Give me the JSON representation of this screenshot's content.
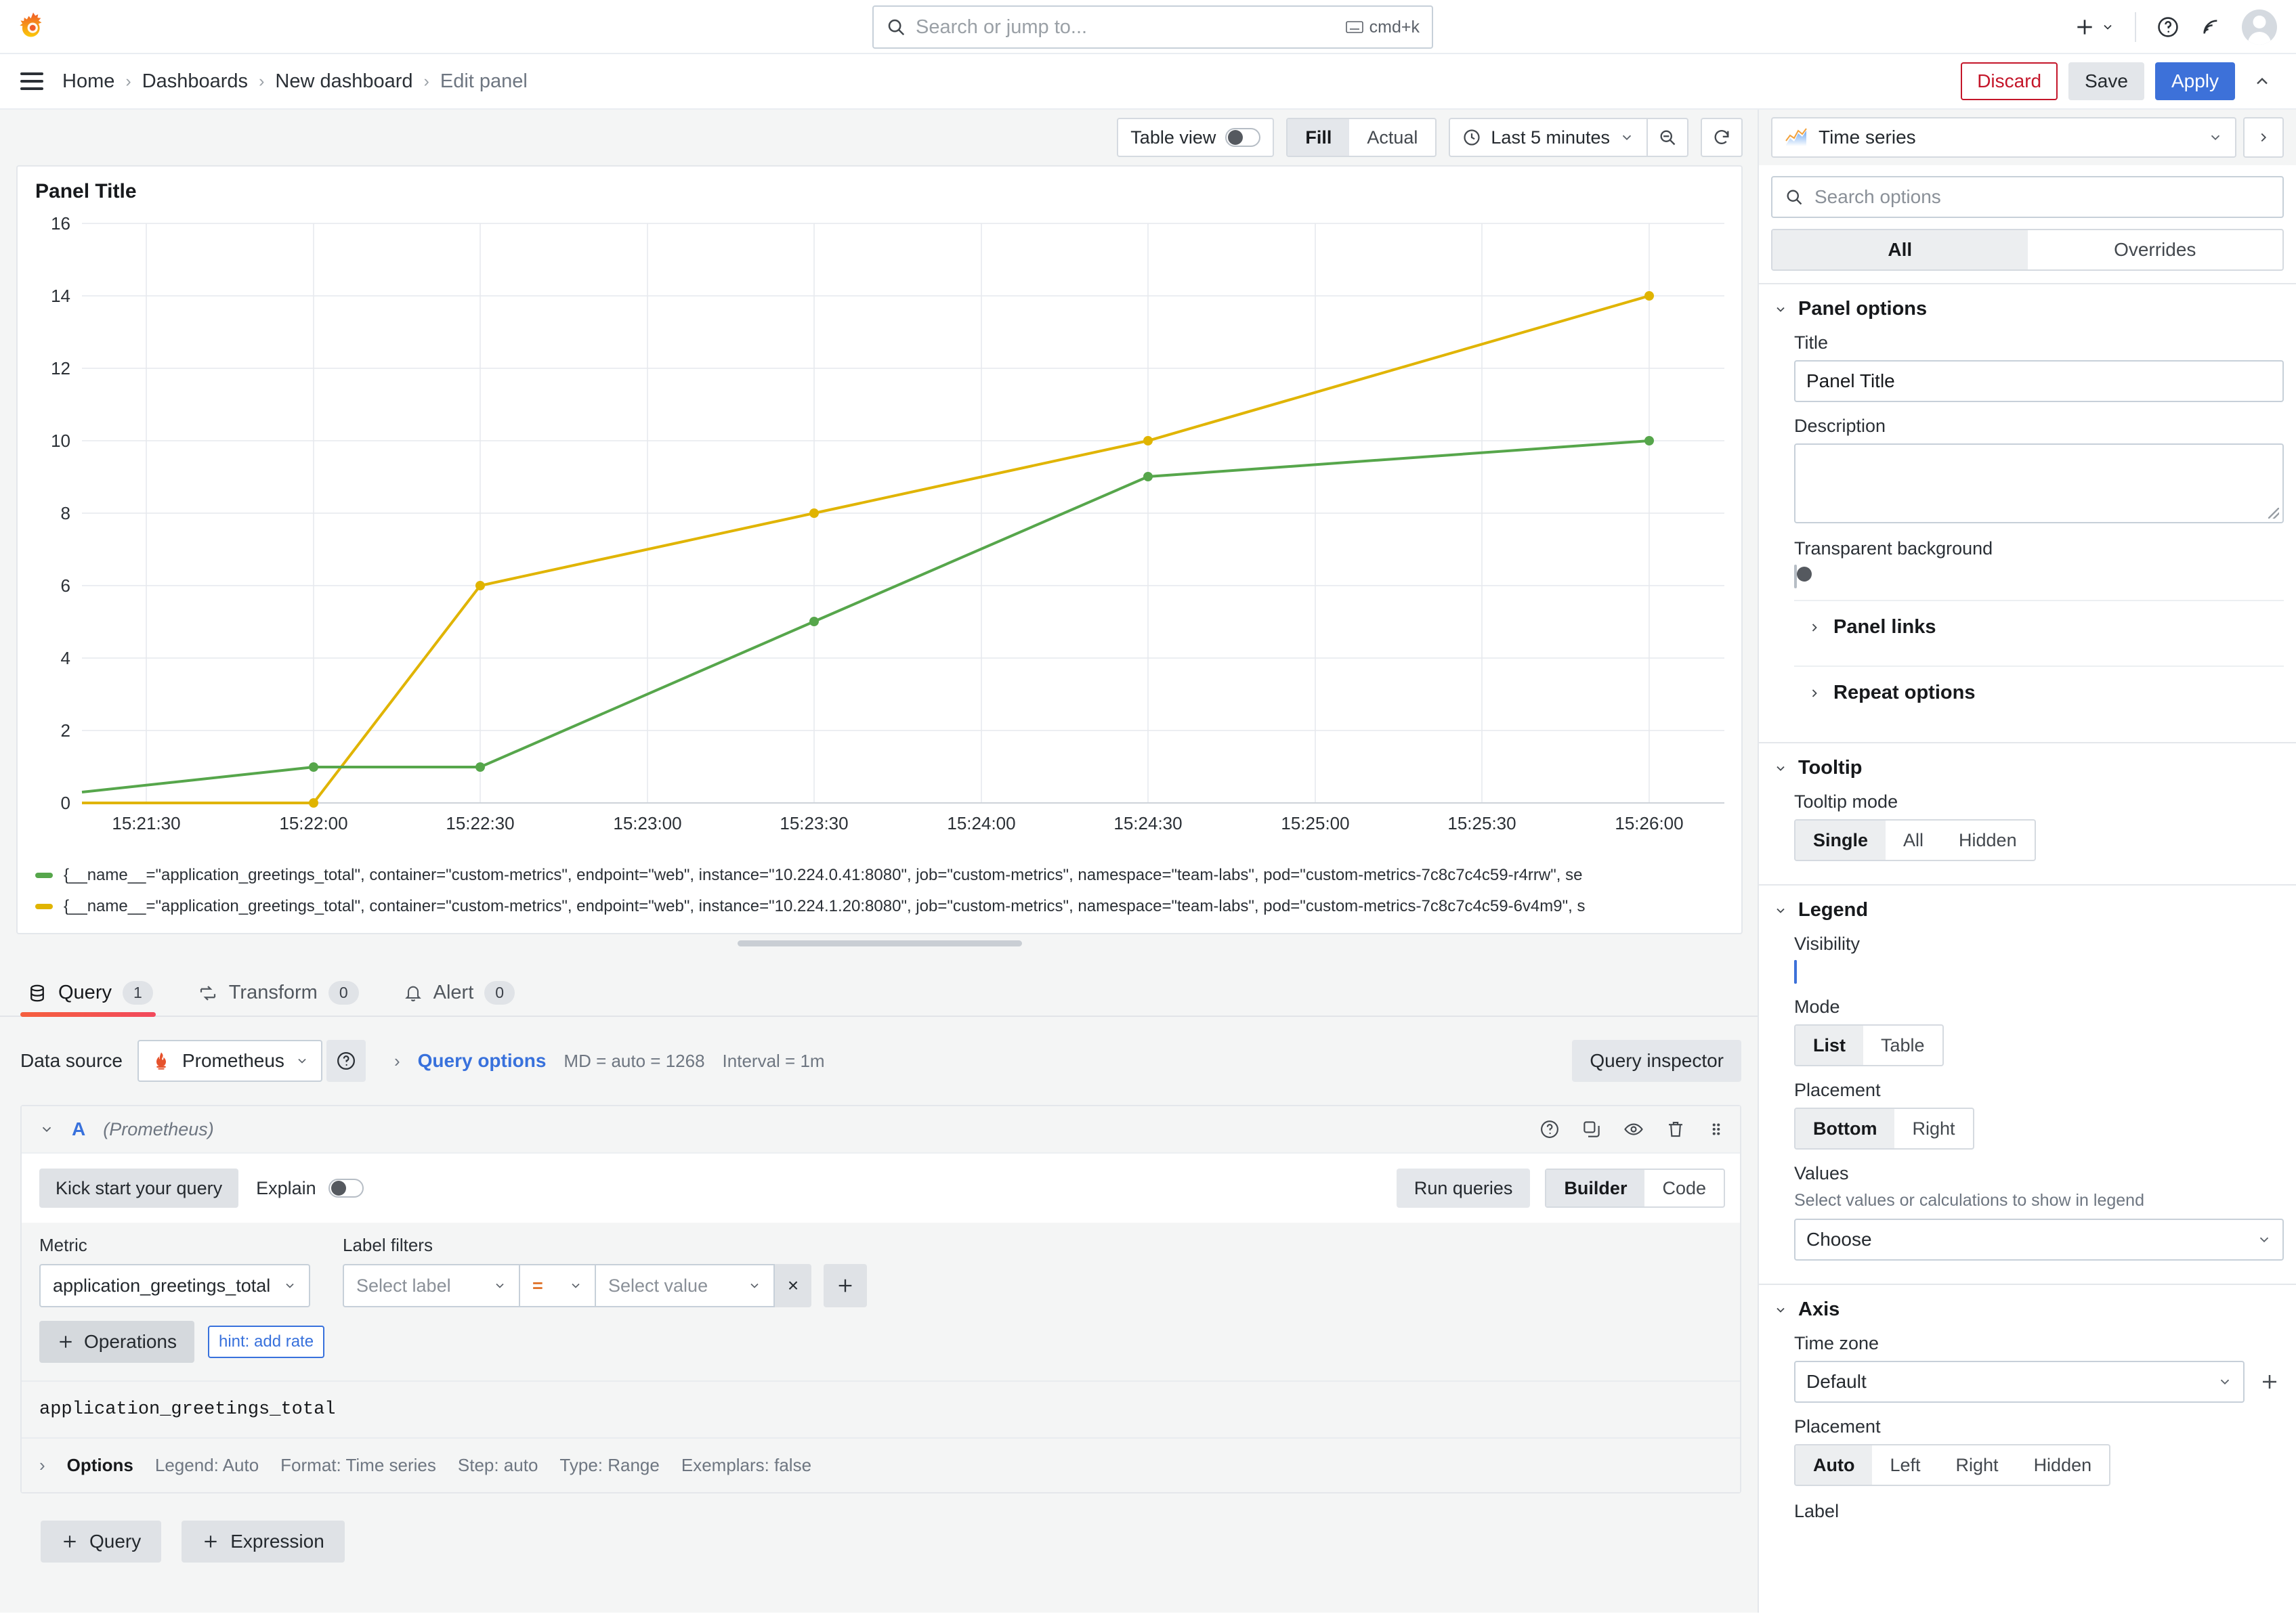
{
  "topnav": {
    "logo_icon": "grafana-logo-icon",
    "search_placeholder": "Search or jump to...",
    "search_value": "",
    "kbd_shortcut": "cmd+k",
    "add_icon": "plus-icon",
    "help_icon": "question-circle-icon",
    "news_icon": "rss-icon",
    "avatar_icon": "user-avatar-icon"
  },
  "breadcrumb": {
    "menu_icon": "hamburger-menu-icon",
    "items": [
      "Home",
      "Dashboards",
      "New dashboard",
      "Edit panel"
    ],
    "separator": "›",
    "discard_label": "Discard",
    "save_label": "Save",
    "apply_label": "Apply",
    "collapse_icon": "chevron-up-icon"
  },
  "panel_toolbar": {
    "table_view_label": "Table view",
    "table_view_on": false,
    "fill_actual": [
      "Fill",
      "Actual"
    ],
    "fill_actual_selected": "Fill",
    "time_range": "Last 5 minutes",
    "time_icon": "clock-icon",
    "zoom_out_icon": "zoom-out-icon",
    "refresh_icon": "refresh-icon"
  },
  "panel": {
    "title": "Panel Title",
    "legend": [
      {
        "color": "#56a64b",
        "text": "{__name__=\"application_greetings_total\", container=\"custom-metrics\", endpoint=\"web\", instance=\"10.224.0.41:8080\", job=\"custom-metrics\", namespace=\"team-labs\", pod=\"custom-metrics-7c8c7c4c59-r4rrw\", se"
      },
      {
        "color": "#e0b400",
        "text": "{__name__=\"application_greetings_total\", container=\"custom-metrics\", endpoint=\"web\", instance=\"10.224.1.20:8080\", job=\"custom-metrics\", namespace=\"team-labs\", pod=\"custom-metrics-7c8c7c4c59-6v4m9\", s"
      }
    ]
  },
  "chart_data": {
    "type": "line",
    "title": "Panel Title",
    "xlabel": "",
    "ylabel": "",
    "ylim": [
      0,
      16
    ],
    "yticks": [
      0,
      2,
      4,
      6,
      8,
      10,
      12,
      14,
      16
    ],
    "xticks": [
      "15:21:30",
      "15:22:00",
      "15:22:30",
      "15:23:00",
      "15:23:30",
      "15:24:00",
      "15:24:30",
      "15:25:00",
      "15:25:30",
      "15:26:00"
    ],
    "grid": true,
    "legend_position": "bottom",
    "x": [
      "15:21:20",
      "15:22:00",
      "15:23:00",
      "15:24:00",
      "15:25:00",
      "15:26:00"
    ],
    "series": [
      {
        "name": "{__name__=\"application_greetings_total\", instance=\"10.224.0.41:8080\", pod=\"custom-metrics-7c8c7c4c59-r4rrw\"}",
        "color": "#56a64b",
        "values": [
          0.3,
          1,
          1,
          5,
          9,
          10
        ]
      },
      {
        "name": "{__name__=\"application_greetings_total\", instance=\"10.224.1.20:8080\", pod=\"custom-metrics-7c8c7c4c59-6v4m9\"}",
        "color": "#e0b400",
        "values": [
          0,
          0,
          6,
          8,
          10,
          14
        ]
      }
    ]
  },
  "query_tabs": [
    {
      "label": "Query",
      "count": "1",
      "icon": "database-icon",
      "active": true
    },
    {
      "label": "Transform",
      "count": "0",
      "icon": "transform-icon",
      "active": false
    },
    {
      "label": "Alert",
      "count": "0",
      "icon": "bell-icon",
      "active": false
    }
  ],
  "datasource": {
    "label": "Data source",
    "name": "Prometheus",
    "icon": "prometheus-icon",
    "help_icon": "question-circle-icon",
    "query_options_label": "Query options",
    "max_data_points": "MD = auto = 1268",
    "interval": "Interval = 1m",
    "query_inspector_label": "Query inspector"
  },
  "query_a": {
    "ref_id": "A",
    "datasource_name": "(Prometheus)",
    "collapse_icon": "chevron-down-icon",
    "icons": [
      "help-icon",
      "duplicate-icon",
      "eye-icon",
      "trash-icon",
      "drag-handle-icon"
    ],
    "kick_start_label": "Kick start your query",
    "explain_label": "Explain",
    "explain_on": false,
    "run_queries_label": "Run queries",
    "editor_modes": [
      "Builder",
      "Code"
    ],
    "editor_mode_selected": "Builder",
    "metric_label": "Metric",
    "metric_value": "application_greetings_total",
    "label_filters_label": "Label filters",
    "filter_label_placeholder": "Select label",
    "filter_operator": "=",
    "filter_value_placeholder": "Select value",
    "remove_filter_icon": "close-icon",
    "add_filter_icon": "plus-icon",
    "operations_label": "Operations",
    "hint_label": "hint: add rate",
    "promql": "application_greetings_total",
    "options_label": "Options",
    "options_summary": [
      "Legend: Auto",
      "Format: Time series",
      "Step: auto",
      "Type: Range",
      "Exemplars: false"
    ]
  },
  "add_buttons": {
    "query_label": "Query",
    "expression_label": "Expression",
    "plus_icon": "plus-icon"
  },
  "options_pane": {
    "viz_name": "Time series",
    "viz_icon": "timeseries-icon",
    "viz_chevron_icon": "chevron-down-icon",
    "viz_next_icon": "chevron-right-icon",
    "search_placeholder": "Search options",
    "search_value": "",
    "tabs": [
      "All",
      "Overrides"
    ],
    "tab_selected": "All",
    "panel_options": {
      "header": "Panel options",
      "title_label": "Title",
      "title_value": "Panel Title",
      "description_label": "Description",
      "description_value": "",
      "transparent_label": "Transparent background",
      "transparent_on": false,
      "panel_links_label": "Panel links",
      "repeat_options_label": "Repeat options"
    },
    "tooltip": {
      "header": "Tooltip",
      "mode_label": "Tooltip mode",
      "mode_options": [
        "Single",
        "All",
        "Hidden"
      ],
      "mode_selected": "Single"
    },
    "legend": {
      "header": "Legend",
      "visibility_label": "Visibility",
      "visibility_on": true,
      "mode_label": "Mode",
      "mode_options": [
        "List",
        "Table"
      ],
      "mode_selected": "List",
      "placement_label": "Placement",
      "placement_options": [
        "Bottom",
        "Right"
      ],
      "placement_selected": "Bottom",
      "values_label": "Values",
      "values_help": "Select values or calculations to show in legend",
      "values_placeholder": "Choose"
    },
    "axis": {
      "header": "Axis",
      "timezone_label": "Time zone",
      "timezone_value": "Default",
      "add_timezone_icon": "plus-icon",
      "placement_label": "Placement",
      "placement_options": [
        "Auto",
        "Left",
        "Right",
        "Hidden"
      ],
      "placement_selected": "Auto",
      "label_label": "Label"
    }
  }
}
